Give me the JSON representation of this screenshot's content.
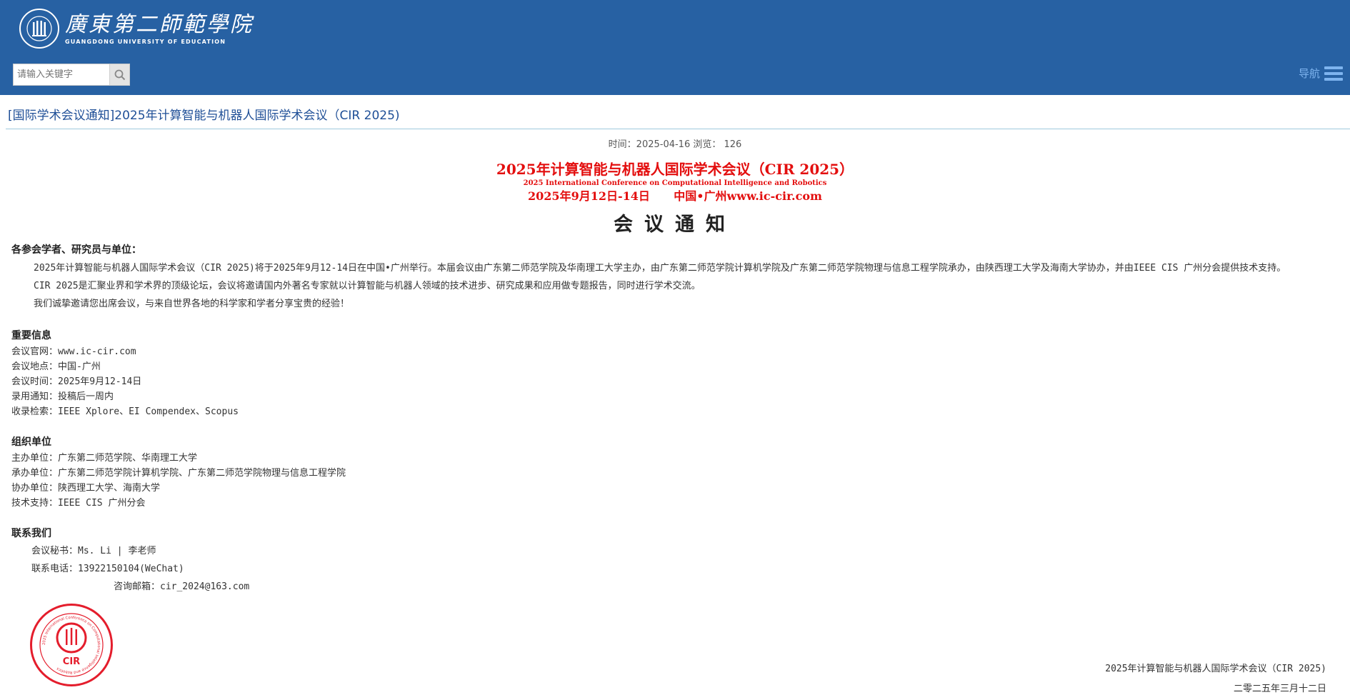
{
  "header": {
    "logo_cn": "廣東第二師範學院",
    "logo_en": "GUANGDONG UNIVERSITY OF EDUCATION",
    "search_placeholder": "请输入关键字",
    "nav_label": "导航",
    "bg_color": "#2761a3"
  },
  "article": {
    "title": "[国际学术会议通知]2025年计算智能与机器人国际学术会议（CIR 2025)",
    "meta": "时间：2025-04-16  浏览： 126"
  },
  "conference": {
    "title_cn": "2025年计算智能与机器人国际学术会议（CIR 2025）",
    "title_en": "2025 International Conference on Computational Intelligence and Robotics",
    "date_place": "2025年9月12日-14日      中国•广州www.ic-cir.com",
    "notice": "会议通知",
    "accent_color": "#e30e0e"
  },
  "intro": {
    "salutation": "各参会学者、研究员与单位：",
    "p1": "2025年计算智能与机器人国际学术会议（CIR 2025)将于2025年9月12-14日在中国•广州举行。本届会议由广东第二师范学院及华南理工大学主办，由广东第二师范学院计算机学院及广东第二师范学院物理与信息工程学院承办，由陕西理工大学及海南大学协办，并由IEEE CIS 广州分会提供技术支持。",
    "p2": "CIR 2025是汇聚业界和学术界的顶级论坛，会议将邀请国内外著名专家就以计算智能与机器人领域的技术进步、研究成果和应用做专题报告，同时进行学术交流。",
    "p3": "我们诚挚邀请您出席会议，与来自世界各地的科学家和学者分享宝贵的经验！"
  },
  "important": {
    "title": "重要信息",
    "items": [
      "会议官网：www.ic-cir.com",
      "会议地点：中国-广州",
      "会议时间：2025年9月12-14日",
      "录用通知：投稿后一周内",
      "收录检索：IEEE Xplore、EI Compendex、Scopus"
    ]
  },
  "organizers": {
    "title": "组织单位",
    "items": [
      "主办单位：广东第二师范学院、华南理工大学",
      "承办单位：广东第二师范学院计算机学院、广东第二师范学院物理与信息工程学院",
      "协办单位：陕西理工大学、海南大学",
      "技术支持：IEEE CIS 广州分会"
    ]
  },
  "contact": {
    "title": "联系我们",
    "secretary": "会议秘书：Ms. Li | 李老师",
    "phone": "联系电话：13922150104(WeChat)",
    "email": "咨询邮箱：cir_2024@163.com"
  },
  "seal": {
    "label": "CIR",
    "ring_text": "2025 International Conference on Computational Intelligence and Robotics",
    "color": "#e41d2c"
  },
  "signature": {
    "org": "2025年计算智能与机器人国际学术会议（CIR 2025)",
    "date": "二零二五年三月十二日"
  }
}
